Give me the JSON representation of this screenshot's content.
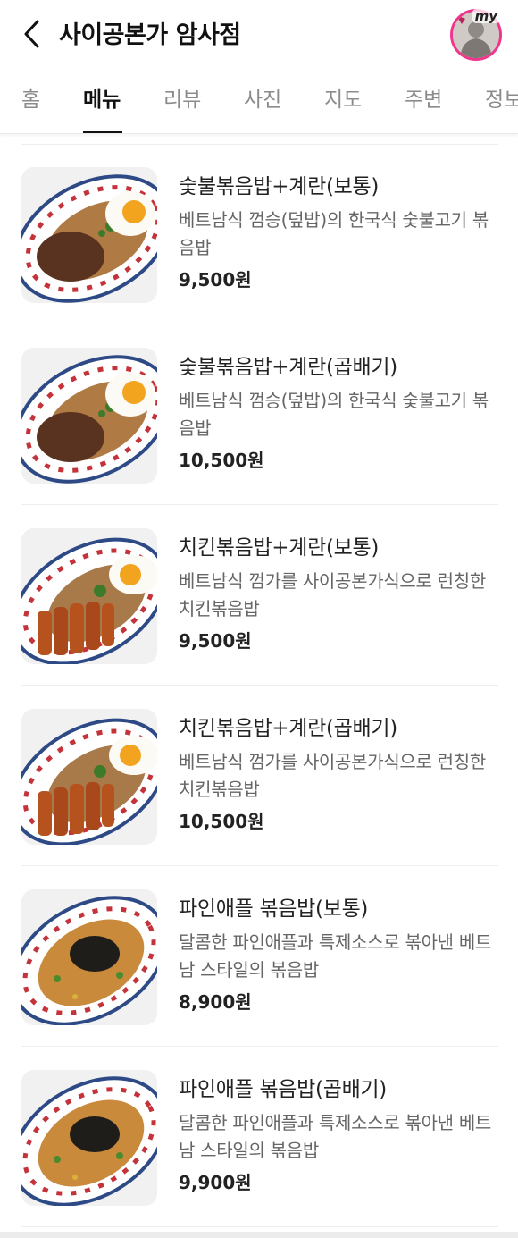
{
  "header": {
    "title": "사이공본가 암사점",
    "back_icon": "chevron-left-icon",
    "avatar_tag": "my"
  },
  "tabs": [
    {
      "label": "홈",
      "active": false
    },
    {
      "label": "메뉴",
      "active": true
    },
    {
      "label": "리뷰",
      "active": false
    },
    {
      "label": "사진",
      "active": false
    },
    {
      "label": "지도",
      "active": false
    },
    {
      "label": "주변",
      "active": false
    },
    {
      "label": "정보",
      "active": false
    }
  ],
  "menu": [
    {
      "name": "숯불볶음밥+계란(보통)",
      "desc": "베트남식 껌승(덮밥)의 한국식 숯불고기 볶음밥",
      "price": "9,500원"
    },
    {
      "name": "숯불볶음밥+계란(곱배기)",
      "desc": "베트남식 껌승(덮밥)의 한국식 숯불고기 볶음밥",
      "price": "10,500원"
    },
    {
      "name": "치킨볶음밥+계란(보통)",
      "desc": "베트남식 껌가를 사이공본가식으로 런칭한 치킨볶음밥",
      "price": "9,500원"
    },
    {
      "name": "치킨볶음밥+계란(곱배기)",
      "desc": "베트남식 껌가를 사이공본가식으로 런칭한 치킨볶음밥",
      "price": "10,500원"
    },
    {
      "name": "파인애플 볶음밥(보통)",
      "desc": "달콤한 파인애플과 특제소스로 볶아낸 베트남 스타일의 볶음밥",
      "price": "8,900원"
    },
    {
      "name": "파인애플 볶음밥(곱배기)",
      "desc": "달콤한 파인애플과 특제소스로 볶아낸 베트남 스타일의 볶음밥",
      "price": "9,900원"
    }
  ],
  "colors": {
    "accent": "#f0358b",
    "text": "#222222",
    "muted": "#8b8b8b",
    "divider": "#eeeeee"
  }
}
